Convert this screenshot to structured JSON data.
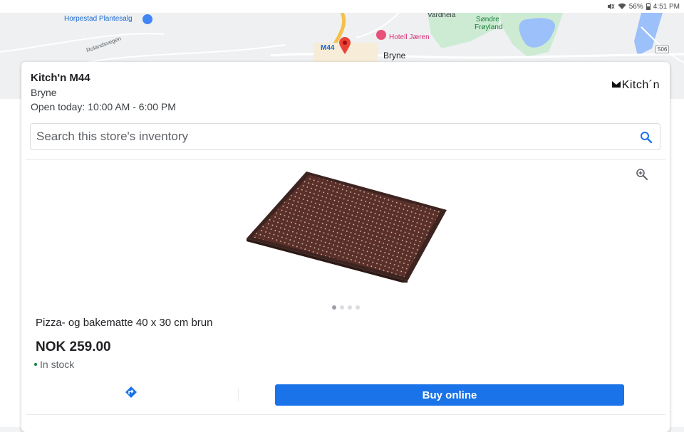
{
  "status_bar": {
    "battery": "56%",
    "time": "4:51 PM",
    "icons": [
      "mute-icon",
      "wifi-icon",
      "battery-icon"
    ]
  },
  "map": {
    "labels": {
      "plantesalg": "Horpestad Plantesalg",
      "vardheia": "Vardheia",
      "sondre": "Søndre",
      "froyland": "Frøyland",
      "hotell": "Hotell Jæren",
      "m44": "M44",
      "bryne": "Bryne",
      "roland": "Rolandsvegen",
      "road_506": "506"
    }
  },
  "store": {
    "name": "Kitch'n M44",
    "city": "Bryne",
    "hours": "Open today: 10:00 AM - 6:00 PM",
    "brand": "Kitch´n"
  },
  "search": {
    "placeholder": "Search this store's inventory"
  },
  "product": {
    "name": "Pizza- og bakematte 40 x 30 cm brun",
    "price": "NOK 259.00",
    "stock": "In stock",
    "image_count": 4,
    "active_image": 0
  },
  "actions": {
    "buy_label": "Buy online"
  },
  "colors": {
    "accent": "#1a73e8",
    "in_stock": "#188038",
    "product_brown": "#4a2a22"
  }
}
